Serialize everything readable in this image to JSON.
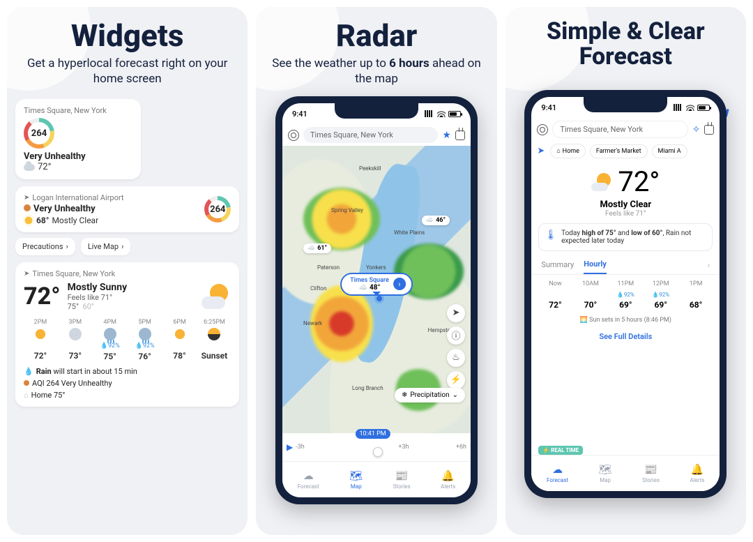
{
  "panel1": {
    "headline": "Widgets",
    "sub": "Get a hyperlocal forecast right on your home screen",
    "w1": {
      "loc": "Times Square, New York",
      "aqi": "264",
      "cond": "Very Unhealthy",
      "temp": "72°"
    },
    "w2": {
      "loc": "Logan International Airport",
      "cond": "Very Unhealthy",
      "temp": "68°",
      "sky": "Mostly Clear",
      "aqi": "264",
      "chip1": "Precautions",
      "chip2": "Live Map"
    },
    "w3": {
      "loc": "Times Square, New York",
      "temp": "72°",
      "cond": "Mostly Sunny",
      "feel": "Feels like 71°",
      "hi": "75°",
      "lo": "60°",
      "hours": [
        {
          "t": "2PM",
          "pop": "",
          "tmp": "72°",
          "ic": "sun"
        },
        {
          "t": "3PM",
          "pop": "",
          "tmp": "73°",
          "ic": "cloud"
        },
        {
          "t": "4PM",
          "pop": "92%",
          "tmp": "75°",
          "ic": "rain"
        },
        {
          "t": "5PM",
          "pop": "92%",
          "tmp": "76°",
          "ic": "rain"
        },
        {
          "t": "6PM",
          "pop": "",
          "tmp": "78°",
          "ic": "sun"
        },
        {
          "t": "6:25PM",
          "pop": "",
          "tmp": "Sunset",
          "ic": "sunset"
        }
      ],
      "note_rain_a": "Rain",
      "note_rain_b": " will start in about 15 min",
      "note_aqi": "AQI 264 Very Unhealthy",
      "note_home": "Home 75°"
    }
  },
  "panel2": {
    "headline": "Radar",
    "sub_a": "See the weather up to ",
    "sub_b": "6 hours",
    "sub_c": " ahead on the map",
    "time": "9:41",
    "search": "Times Square, New York",
    "cities": {
      "peekskill": "Peekskill",
      "springvalley": "Spring Valley",
      "whiteplains": "White Plains",
      "paterson": "Paterson",
      "yonkers": "Yonkers",
      "clifton": "Clifton",
      "newark": "Newark",
      "hempstead": "Hempstead",
      "longbranch": "Long Branch"
    },
    "badges": {
      "b46": "46°",
      "b61": "61°",
      "b48": "48°"
    },
    "callout_loc": "Times Square",
    "callout_temp": "48°",
    "layer": "Precipitation",
    "timeline": {
      "m3": "-3h",
      "now": "10:41 PM",
      "p3": "+3h",
      "p6": "+6h"
    },
    "tabs": {
      "forecast": "Forecast",
      "map": "Map",
      "stories": "Stories",
      "alerts": "Alerts"
    }
  },
  "panel3": {
    "headline": "Simple & Clear Forecast",
    "time": "9:41",
    "search": "Times Square, New York",
    "chips": {
      "home": "Home",
      "farmers": "Farmer's Market",
      "miami": "Miami A"
    },
    "hero": {
      "temp": "72°",
      "cond": "Mostly Clear",
      "feel": "Feels like 71°"
    },
    "summary_a": "Today ",
    "summary_b": "high of 75°",
    "summary_c": " and ",
    "summary_d": "low of 60°",
    "summary_e": ", Rain not expected later today",
    "tab_summary": "Summary",
    "tab_hourly": "Hourly",
    "hours": [
      {
        "t": "Now",
        "pop": "",
        "tmp": "72°",
        "ic": "sun"
      },
      {
        "t": "10AM",
        "pop": "",
        "tmp": "70°",
        "ic": "cloud"
      },
      {
        "t": "11PM",
        "pop": "92%",
        "tmp": "69°",
        "ic": "rain"
      },
      {
        "t": "12PM",
        "pop": "92%",
        "tmp": "69°",
        "ic": "rain"
      },
      {
        "t": "1PM",
        "pop": "",
        "tmp": "68°",
        "ic": "rain"
      }
    ],
    "sunset": "Sun sets in 5 hours (8:46 PM)",
    "seefull": "See Full Details",
    "realtime": "REAL TIME",
    "tabs": {
      "forecast": "Forecast",
      "map": "Map",
      "stories": "Stories",
      "alerts": "Alerts"
    }
  }
}
